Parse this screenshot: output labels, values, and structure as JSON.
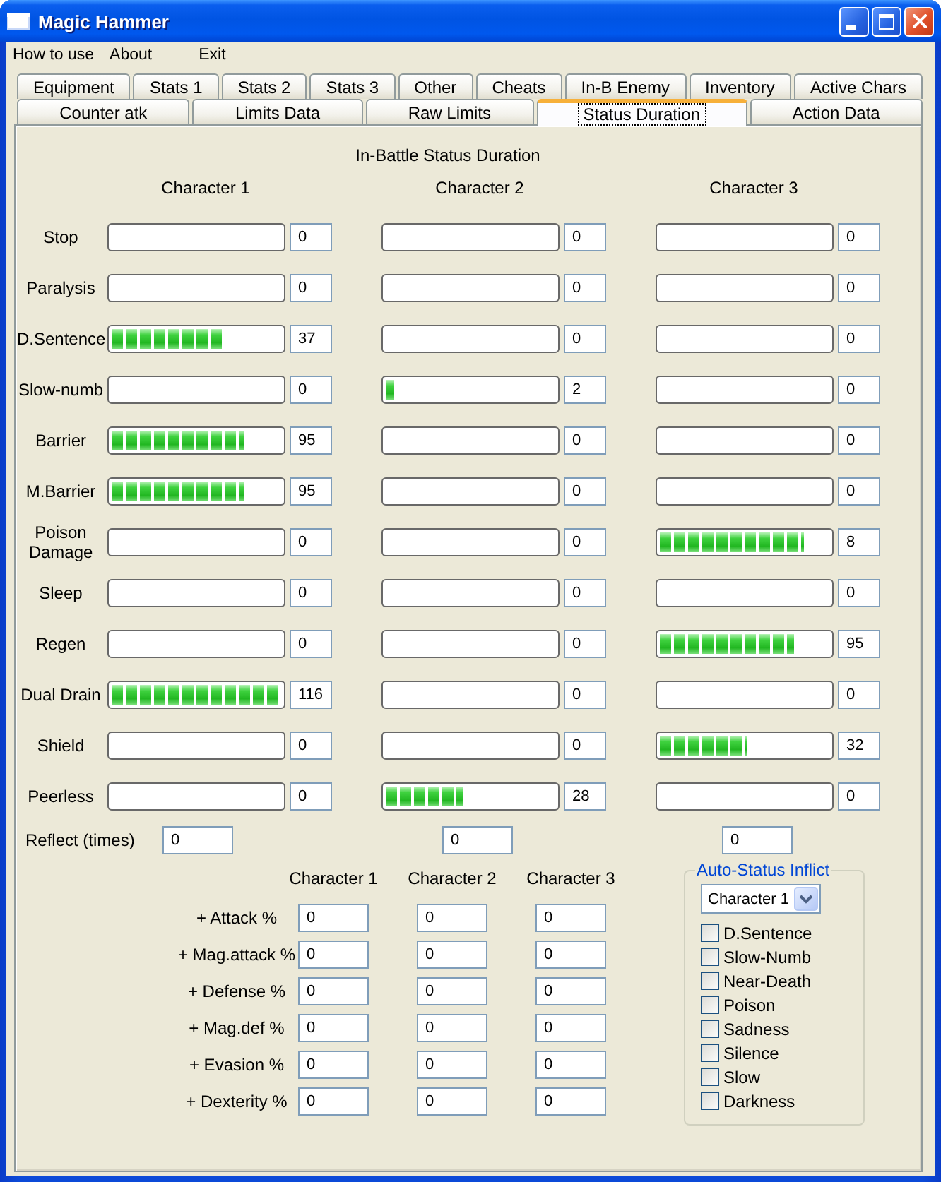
{
  "window": {
    "title": "Magic Hammer"
  },
  "menu": [
    "How to use",
    "About",
    "Exit"
  ],
  "tab_rows": [
    [
      {
        "label": "Equipment",
        "selected": false
      },
      {
        "label": "Stats 1",
        "selected": false
      },
      {
        "label": "Stats 2",
        "selected": false
      },
      {
        "label": "Stats 3",
        "selected": false
      },
      {
        "label": "Other",
        "selected": false
      },
      {
        "label": "Cheats",
        "selected": false
      },
      {
        "label": "In-B Enemy",
        "selected": false
      },
      {
        "label": "Inventory",
        "selected": false
      },
      {
        "label": "Active Chars",
        "selected": false
      }
    ],
    [
      {
        "label": "Counter atk",
        "selected": false
      },
      {
        "label": "Limits Data",
        "selected": false
      },
      {
        "label": "Raw Limits",
        "selected": false
      },
      {
        "label": "Status Duration",
        "selected": true
      },
      {
        "label": "Action Data",
        "selected": false
      }
    ]
  ],
  "status_duration": {
    "title": "In-Battle Status Duration",
    "columns": [
      "Character 1",
      "Character 2",
      "Character 3"
    ],
    "rows": [
      {
        "label": "Stop",
        "cells": [
          {
            "level": 0,
            "value": "0"
          },
          {
            "level": 0,
            "value": "0"
          },
          {
            "level": 0,
            "value": "0"
          }
        ]
      },
      {
        "label": "Paralysis",
        "cells": [
          {
            "level": 0,
            "value": "0"
          },
          {
            "level": 0,
            "value": "0"
          },
          {
            "level": 0,
            "value": "0"
          }
        ]
      },
      {
        "label": "D.Sentence",
        "cells": [
          {
            "level": 0.65,
            "value": "37"
          },
          {
            "level": 0,
            "value": "0"
          },
          {
            "level": 0,
            "value": "0"
          }
        ]
      },
      {
        "label": "Slow-numb",
        "cells": [
          {
            "level": 0,
            "value": "0"
          },
          {
            "level": 0.05,
            "value": "2"
          },
          {
            "level": 0,
            "value": "0"
          }
        ]
      },
      {
        "label": "Barrier",
        "cells": [
          {
            "level": 0.78,
            "value": "95"
          },
          {
            "level": 0,
            "value": "0"
          },
          {
            "level": 0,
            "value": "0"
          }
        ]
      },
      {
        "label": "M.Barrier",
        "cells": [
          {
            "level": 0.78,
            "value": "95"
          },
          {
            "level": 0,
            "value": "0"
          },
          {
            "level": 0,
            "value": "0"
          }
        ]
      },
      {
        "label": "Poison Damage",
        "cells": [
          {
            "level": 0,
            "value": "0"
          },
          {
            "level": 0,
            "value": "0"
          },
          {
            "level": 0.85,
            "value": "8"
          }
        ]
      },
      {
        "label": "Sleep",
        "cells": [
          {
            "level": 0,
            "value": "0"
          },
          {
            "level": 0,
            "value": "0"
          },
          {
            "level": 0,
            "value": "0"
          }
        ]
      },
      {
        "label": "Regen",
        "cells": [
          {
            "level": 0,
            "value": "0"
          },
          {
            "level": 0,
            "value": "0"
          },
          {
            "level": 0.79,
            "value": "95"
          }
        ]
      },
      {
        "label": "Dual Drain",
        "cells": [
          {
            "level": 0.98,
            "value": "116"
          },
          {
            "level": 0,
            "value": "0"
          },
          {
            "level": 0,
            "value": "0"
          }
        ]
      },
      {
        "label": "Shield",
        "cells": [
          {
            "level": 0,
            "value": "0"
          },
          {
            "level": 0,
            "value": "0"
          },
          {
            "level": 0.52,
            "value": "32"
          }
        ]
      },
      {
        "label": "Peerless",
        "cells": [
          {
            "level": 0,
            "value": "0"
          },
          {
            "level": 0.46,
            "value": "28"
          },
          {
            "level": 0,
            "value": "0"
          }
        ]
      }
    ],
    "reflect": {
      "label": "Reflect (times)",
      "values": [
        "0",
        "0",
        "0"
      ]
    }
  },
  "bonuses": {
    "columns": [
      "Character 1",
      "Character 2",
      "Character 3"
    ],
    "rows": [
      {
        "label": "+ Attack %",
        "values": [
          "0",
          "0",
          "0"
        ]
      },
      {
        "label": "+ Mag.attack %",
        "values": [
          "0",
          "0",
          "0"
        ]
      },
      {
        "label": "+ Defense %",
        "values": [
          "0",
          "0",
          "0"
        ]
      },
      {
        "label": "+ Mag.def %",
        "values": [
          "0",
          "0",
          "0"
        ]
      },
      {
        "label": "+ Evasion %",
        "values": [
          "0",
          "0",
          "0"
        ]
      },
      {
        "label": "+ Dexterity %",
        "values": [
          "0",
          "0",
          "0"
        ]
      }
    ]
  },
  "auto_status": {
    "title": "Auto-Status Inflict",
    "character": "Character 1",
    "options": [
      {
        "label": "D.Sentence",
        "checked": false
      },
      {
        "label": "Slow-Numb",
        "checked": false
      },
      {
        "label": "Near-Death",
        "checked": false
      },
      {
        "label": "Poison",
        "checked": false
      },
      {
        "label": "Sadness",
        "checked": false
      },
      {
        "label": "Silence",
        "checked": false
      },
      {
        "label": "Slow",
        "checked": false
      },
      {
        "label": "Darkness",
        "checked": false
      }
    ]
  }
}
